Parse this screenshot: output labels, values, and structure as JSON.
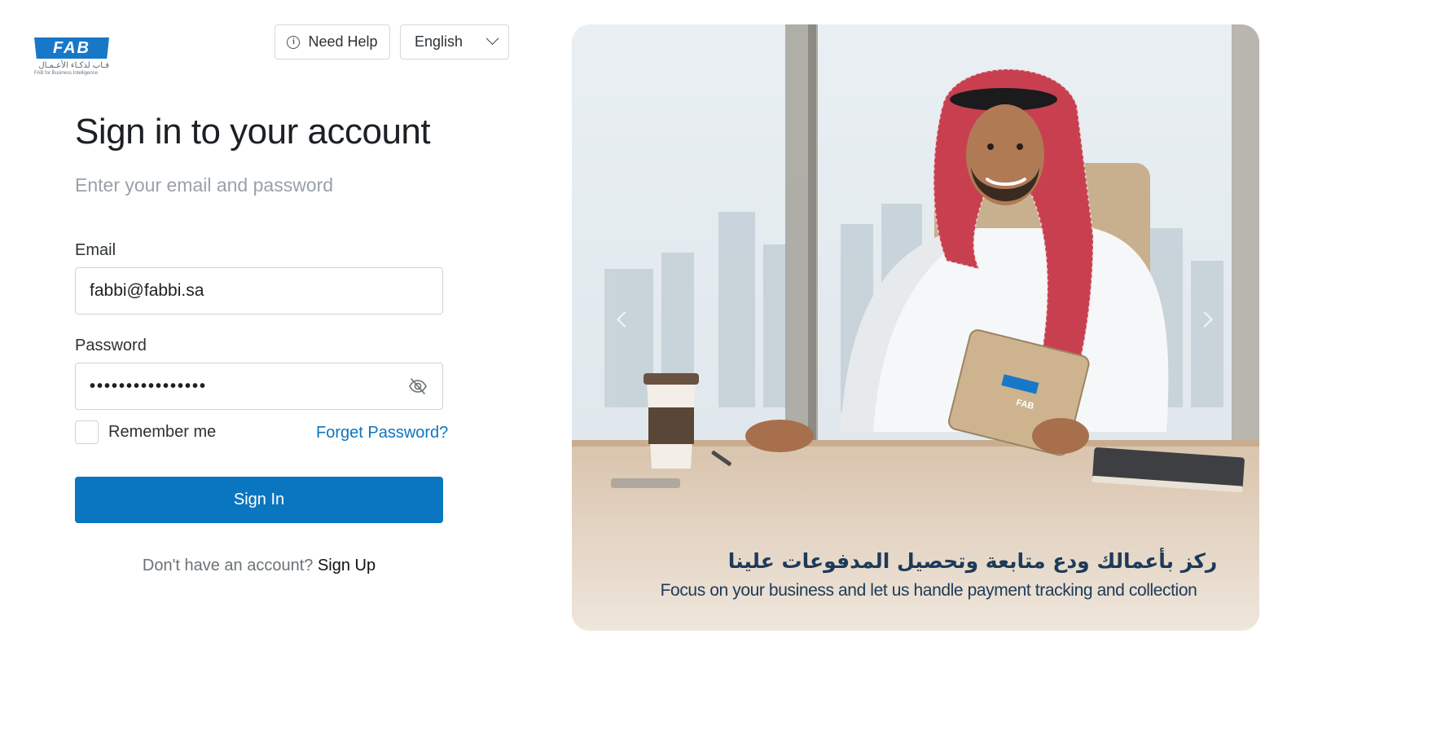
{
  "brand": {
    "logo_mark": "FAB",
    "logo_arabic": "فـاب لذكـاء الأعـمـال",
    "logo_english": "FAB for Business Intelligence",
    "primary_color": "#0b76c0",
    "link_color": "#0f75bd"
  },
  "header": {
    "help_label": "Need Help",
    "help_icon": "info-icon",
    "language": "English"
  },
  "form": {
    "title": "Sign in to your account",
    "subtitle": "Enter your email and password",
    "email_label": "Email",
    "email_value": "fabbi@fabbi.sa",
    "password_label": "Password",
    "password_value": "••••••••••••••••",
    "remember_label": "Remember me",
    "forgot_label": "Forget Password?",
    "submit_label": "Sign In",
    "signup_prompt": "Don't have an account?",
    "signup_link": "Sign Up"
  },
  "hero": {
    "tablet_logo": "FAB",
    "tagline_arabic": "ركز بأعمالك ودع متابعة وتحصيل المدفوعات علينا",
    "tagline_english": "Focus on your business and let us handle payment tracking and collection"
  }
}
